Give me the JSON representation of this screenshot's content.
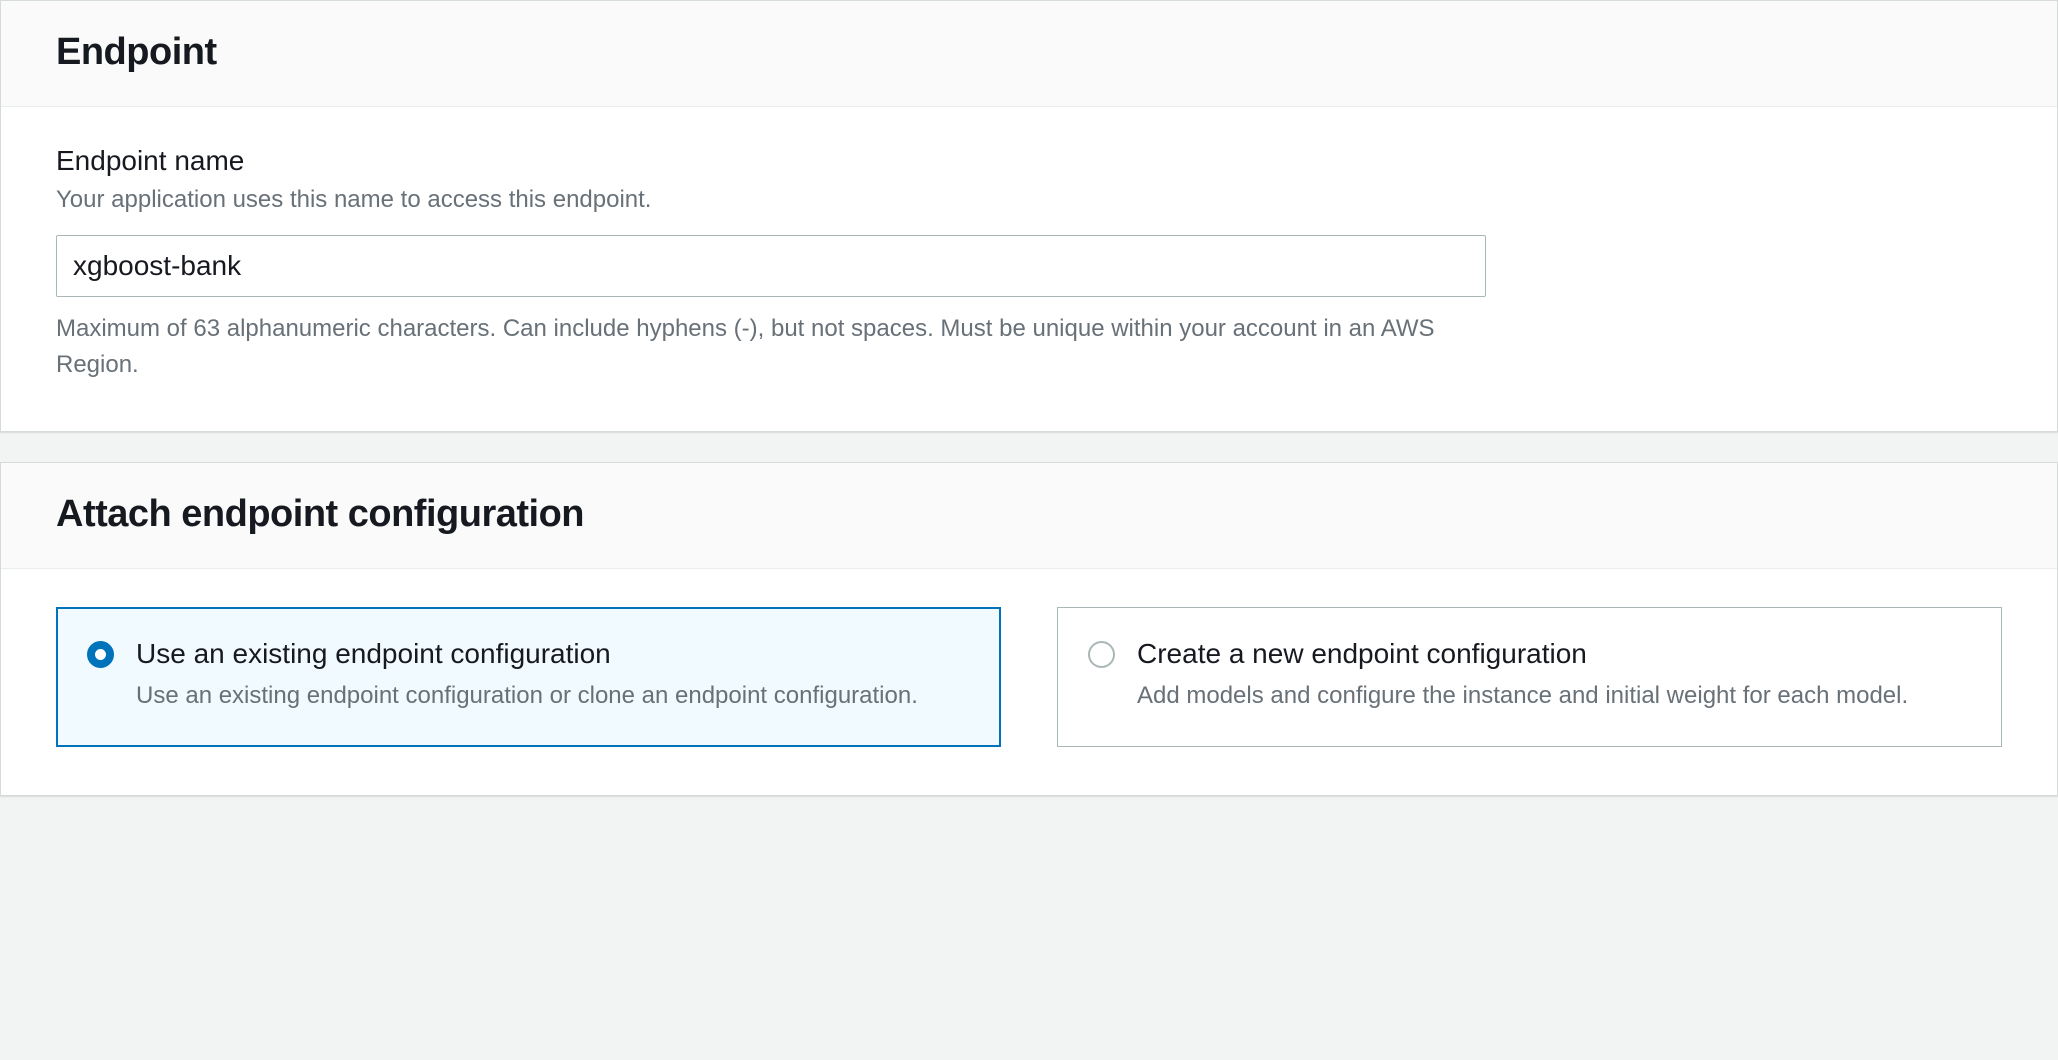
{
  "endpoint_panel": {
    "title": "Endpoint",
    "name_label": "Endpoint name",
    "name_hint": "Your application uses this name to access this endpoint.",
    "name_value": "xgboost-bank",
    "name_constraint": "Maximum of 63 alphanumeric characters. Can include hyphens (-), but not spaces. Must be unique within your account in an AWS Region."
  },
  "config_panel": {
    "title": "Attach endpoint configuration",
    "option_existing": {
      "title": "Use an existing endpoint configuration",
      "description": "Use an existing endpoint configuration or clone an endpoint configuration.",
      "selected": true
    },
    "option_new": {
      "title": "Create a new endpoint configuration",
      "description": "Add models and configure the instance and initial weight for each model.",
      "selected": false
    }
  }
}
